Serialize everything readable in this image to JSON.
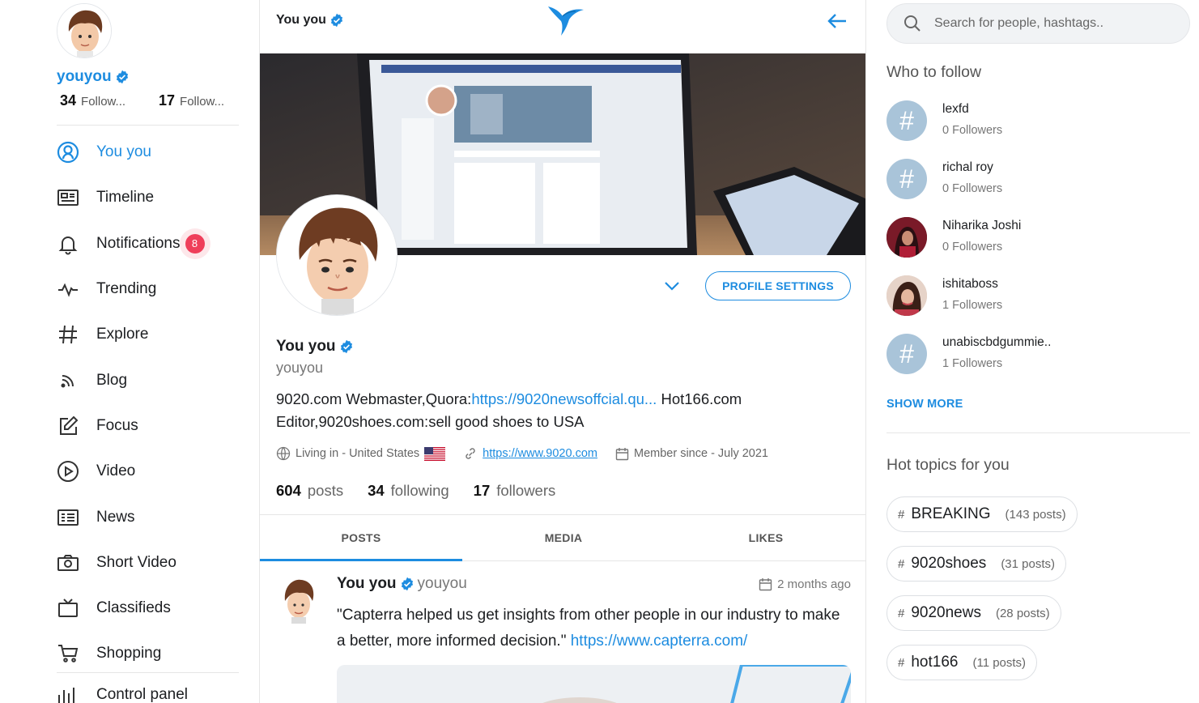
{
  "colors": {
    "accent": "#1d8ce0",
    "badge": "#ef3e5a",
    "text": "#1c1e21",
    "muted": "#777777"
  },
  "sidebar": {
    "username": "youyou",
    "following_count": "34",
    "following_label": "Follow...",
    "followers_count": "17",
    "followers_label": "Follow...",
    "items": [
      {
        "label": "You you",
        "icon": "user-circle-icon",
        "active": true
      },
      {
        "label": "Timeline",
        "icon": "timeline-icon"
      },
      {
        "label": "Notifications",
        "icon": "bell-icon",
        "badge": "8"
      },
      {
        "label": "Trending",
        "icon": "activity-icon"
      },
      {
        "label": "Explore",
        "icon": "hashtag-icon"
      },
      {
        "label": "Blog",
        "icon": "rss-icon"
      },
      {
        "label": "Focus",
        "icon": "edit-icon"
      },
      {
        "label": "Video",
        "icon": "play-circle-icon"
      },
      {
        "label": "News",
        "icon": "newspaper-icon"
      },
      {
        "label": "Short Video",
        "icon": "camera-icon"
      },
      {
        "label": "Classifieds",
        "icon": "tv-icon"
      },
      {
        "label": "Shopping",
        "icon": "cart-icon"
      },
      {
        "label": "Control panel",
        "icon": "bar-chart-icon"
      }
    ]
  },
  "header": {
    "title": "You you"
  },
  "profile": {
    "name": "You you",
    "handle": "youyou",
    "settings_label": "PROFILE SETTINGS",
    "bio_prefix": "9020.com Webmaster,Quora:",
    "bio_link": "https://9020newsoffcial.qu...",
    "bio_suffix": " Hot166.com Editor,9020shoes.com:sell good shoes to USA",
    "location": "Living in - United States",
    "website": "https://www.9020.com",
    "member_since": "Member since - July 2021",
    "posts_count": "604",
    "posts_label": "posts",
    "following_count": "34",
    "following_label": "following",
    "followers_count": "17",
    "followers_label": "followers"
  },
  "tabs": [
    {
      "label": "POSTS",
      "active": true
    },
    {
      "label": "MEDIA"
    },
    {
      "label": "LIKES"
    }
  ],
  "post": {
    "author": "You you",
    "handle": "youyou",
    "time": "2 months ago",
    "text": "\"Capterra helped us get insights from other people in our industry to make a better, more informed decision.\" ",
    "link": "https://www.capterra.com/"
  },
  "search": {
    "placeholder": "Search for people, hashtags.."
  },
  "who_to_follow": {
    "title": "Who to follow",
    "users": [
      {
        "name": "lexfd",
        "followers": "0 Followers",
        "avatar": "hashtag"
      },
      {
        "name": "richal roy",
        "followers": "0 Followers",
        "avatar": "hashtag"
      },
      {
        "name": "Niharika Joshi",
        "followers": "0 Followers",
        "avatar": "photo"
      },
      {
        "name": "ishitaboss",
        "followers": "1 Followers",
        "avatar": "photo"
      },
      {
        "name": "unabiscbdgummie..",
        "followers": "1 Followers",
        "avatar": "hashtag"
      }
    ],
    "show_more": "SHOW MORE"
  },
  "hot_topics": {
    "title": "Hot topics for you",
    "topics": [
      {
        "name": "BREAKING",
        "count": "(143 posts)"
      },
      {
        "name": "9020shoes",
        "count": "(31 posts)"
      },
      {
        "name": "9020news",
        "count": "(28 posts)"
      },
      {
        "name": "hot166",
        "count": "(11 posts)"
      }
    ]
  }
}
